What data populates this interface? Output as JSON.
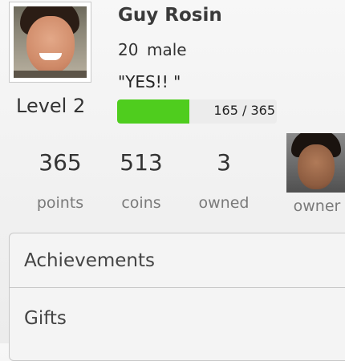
{
  "profile": {
    "name": "Guy Rosin",
    "age": "20",
    "gender": "male",
    "status": "\"YES!! \"",
    "level_label": "Level 2",
    "xp": {
      "current": 165,
      "max": 365,
      "text": "165 / 365",
      "fill_fraction": 0.452,
      "bar_color": "#4fcd1e"
    }
  },
  "stats": [
    {
      "value": "365",
      "label": "points"
    },
    {
      "value": "513",
      "label": "coins"
    },
    {
      "value": "3",
      "label": "owned"
    }
  ],
  "owner": {
    "label": "owner"
  },
  "menu": {
    "items": [
      {
        "label": "Achievements"
      },
      {
        "label": "Gifts"
      }
    ]
  }
}
